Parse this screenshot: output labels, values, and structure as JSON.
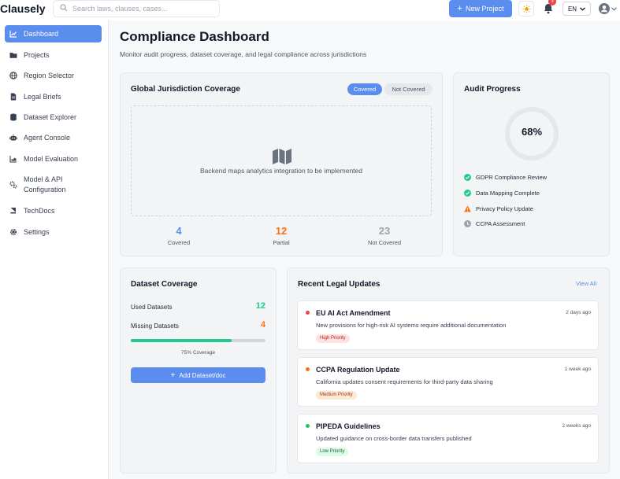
{
  "app": {
    "logo": "Clausely"
  },
  "topbar": {
    "search_placeholder": "Search laws, clauses, cases...",
    "new_project_label": "New Project",
    "notification_count": "3",
    "language": "EN"
  },
  "sidebar": {
    "items": [
      {
        "label": "Dashboard",
        "icon": "chart-line-icon",
        "active": true
      },
      {
        "label": "Projects",
        "icon": "folder-icon"
      },
      {
        "label": "Region Selector",
        "icon": "globe-icon"
      },
      {
        "label": "Legal Briefs",
        "icon": "document-icon"
      },
      {
        "label": "Dataset Explorer",
        "icon": "database-icon"
      },
      {
        "label": "Agent Console",
        "icon": "robot-icon"
      },
      {
        "label": "Model Evaluation",
        "icon": "chart-area-icon"
      },
      {
        "label": "Model & API Configuration",
        "icon": "cogs-icon"
      },
      {
        "label": "TechDocs",
        "icon": "book-icon"
      },
      {
        "label": "Settings",
        "icon": "gear-icon"
      }
    ]
  },
  "page": {
    "title": "Compliance Dashboard",
    "subtitle": "Monitor audit progress, dataset coverage, and legal compliance across jurisdictions"
  },
  "coverage": {
    "title": "Global Jurisdiction Coverage",
    "toggle_on": "Covered",
    "toggle_off": "Not Covered",
    "map_message": "Backend maps analytics integration to be implemented",
    "stats": [
      {
        "value": "4",
        "label": "Covered",
        "color": "#5b8def"
      },
      {
        "value": "12",
        "label": "Partial",
        "color": "#f97316"
      },
      {
        "value": "23",
        "label": "Not Covered",
        "color": "#9ca3af"
      }
    ]
  },
  "audit": {
    "title": "Audit Progress",
    "percent": 68,
    "percent_label": "68%",
    "items": [
      {
        "label": "GDPR Compliance Review",
        "status": "complete"
      },
      {
        "label": "Data Mapping Complete",
        "status": "complete"
      },
      {
        "label": "Privacy Policy Update",
        "status": "warning"
      },
      {
        "label": "CCPA Assessment",
        "status": "pending"
      }
    ]
  },
  "dataset": {
    "title": "Dataset Coverage",
    "used_label": "Used Datasets",
    "used_value": "12",
    "missing_label": "Missing Datasets",
    "missing_value": "4",
    "coverage_percent": 75,
    "coverage_caption": "75% Coverage",
    "add_label": "Add Dataset/doc"
  },
  "updates": {
    "title": "Recent Legal Updates",
    "view_all": "View All",
    "items": [
      {
        "title": "EU AI Act Amendment",
        "desc": "New provisions for high-risk AI systems require additional documentation",
        "time": "2 days ago",
        "priority": "High Priority",
        "dot": "#ef4444",
        "pri_bg": "#fde2e2",
        "pri_fg": "#b91c1c"
      },
      {
        "title": "CCPA Regulation Update",
        "desc": "California updates consent requirements for third-party data sharing",
        "time": "1 week ago",
        "priority": "Medium Priority",
        "dot": "#f97316",
        "pri_bg": "#fde8d4",
        "pri_fg": "#9a3412"
      },
      {
        "title": "PIPEDA Guidelines",
        "desc": "Updated guidance on cross-border data transfers published",
        "time": "2 weeks ago",
        "priority": "Low Priority",
        "dot": "#22c55e",
        "pri_bg": "#dcfce7",
        "pri_fg": "#166534"
      }
    ]
  },
  "colors": {
    "accent": "#5b8def",
    "success": "#22c98e",
    "warning": "#f97316"
  }
}
